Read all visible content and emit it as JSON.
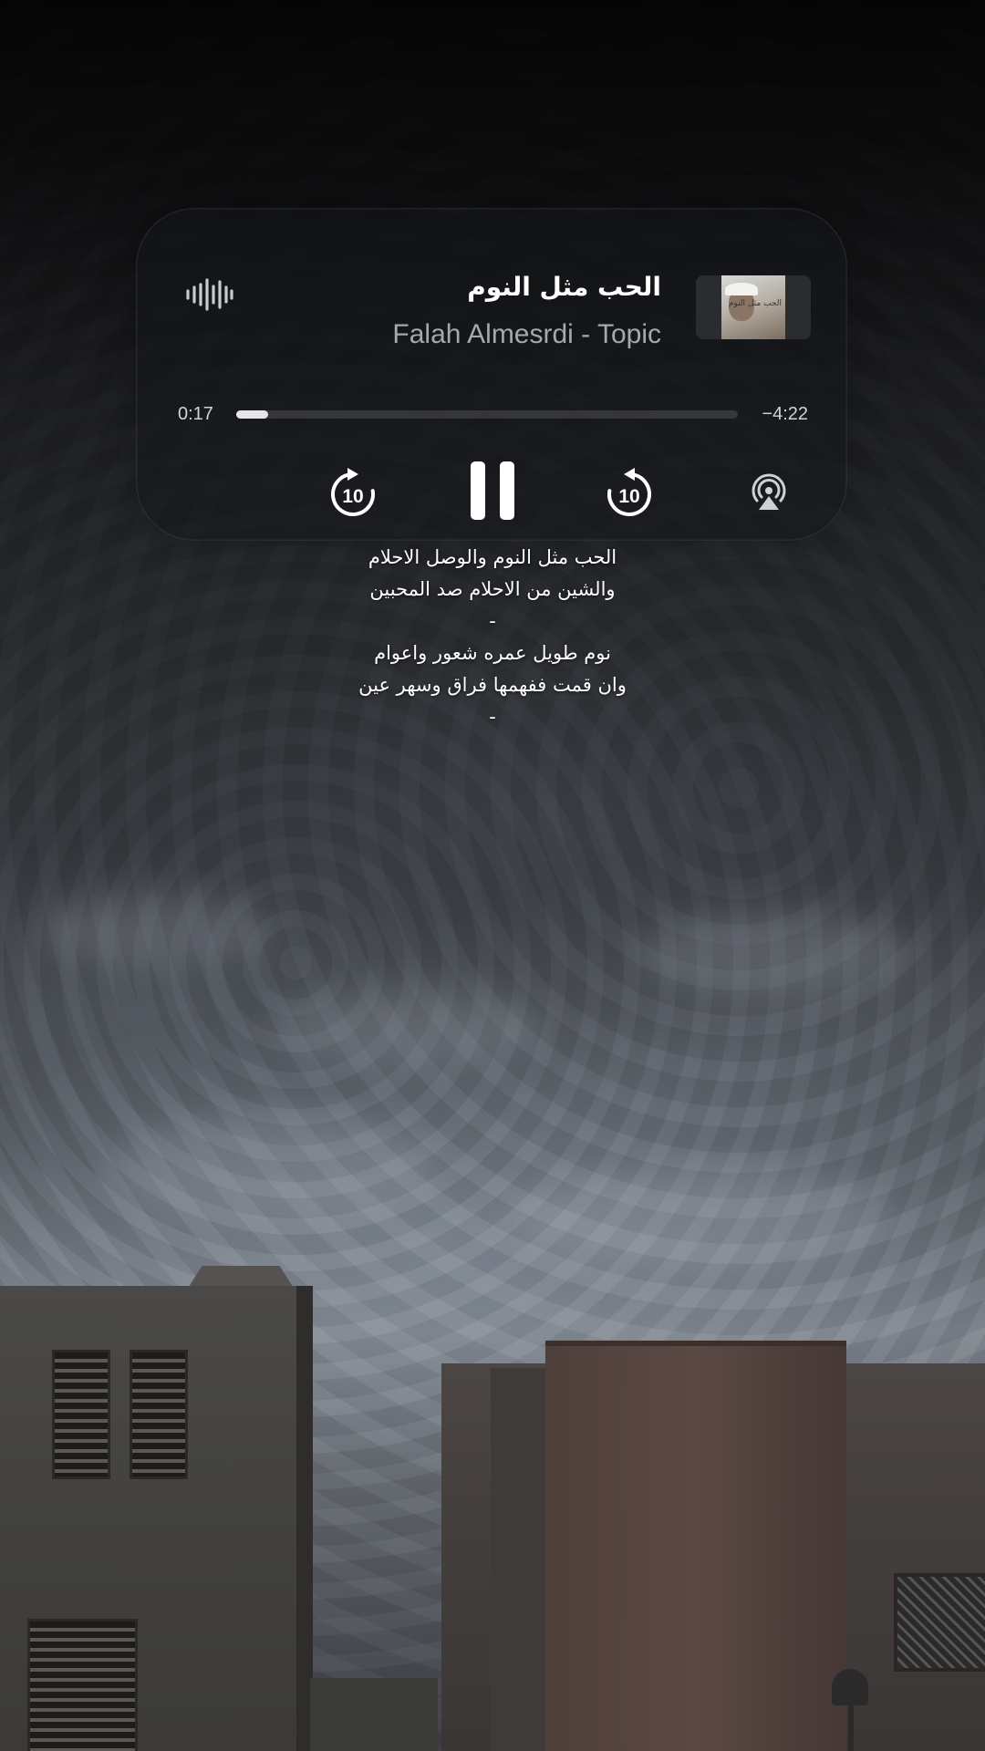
{
  "now_playing": {
    "title": "الحب مثل النوم",
    "artist": "Falah Almesrdi - Topic",
    "artwork_text": "الحب مثل النوم",
    "elapsed": "0:17",
    "remaining": "−4:22",
    "progress_fraction": 0.063
  },
  "controls": {
    "rewind_seconds": "10",
    "forward_seconds": "10",
    "state": "playing"
  },
  "lyrics": [
    "الحب مثل النوم والوصل الاحلام",
    "والشين من الاحلام صد المحبين",
    "-",
    "نوم طويل عمره شعور واعوام",
    "وان قمت ففهمها فراق وسهر عين",
    "-"
  ],
  "colors": {
    "text_primary": "#ffffff",
    "text_secondary": "#a6a8ac",
    "progress_fill": "#e6e6e6"
  }
}
